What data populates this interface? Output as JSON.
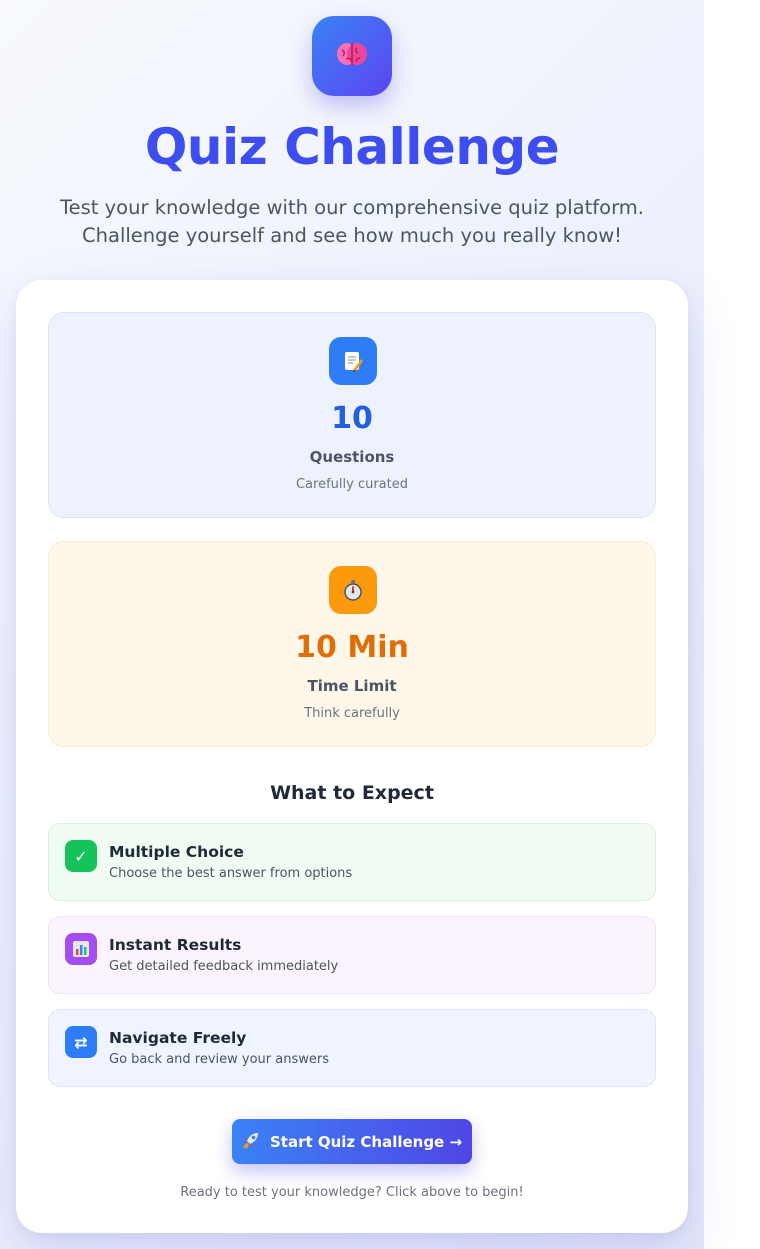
{
  "header": {
    "app_icon": "brain-icon",
    "title": "Quiz Challenge",
    "subtitle": "Test your knowledge with our comprehensive quiz platform. Challenge yourself and see how much you really know!"
  },
  "stats": [
    {
      "icon": "memo-icon",
      "value": "10",
      "label": "Questions",
      "sub": "Carefully curated",
      "accent": "#1f5fe0"
    },
    {
      "icon": "stopwatch-icon",
      "value": "10 Min",
      "label": "Time Limit",
      "sub": "Think carefully",
      "accent": "#de6f07"
    }
  ],
  "expect": {
    "heading": "What to Expect",
    "items": [
      {
        "icon": "checkmark-icon",
        "title": "Multiple Choice",
        "desc": "Choose the best answer from options",
        "color": "#16c35a"
      },
      {
        "icon": "bar-chart-icon",
        "title": "Instant Results",
        "desc": "Get detailed feedback immediately",
        "color": "#a64df2"
      },
      {
        "icon": "swap-arrows-icon",
        "title": "Navigate Freely",
        "desc": "Go back and review your answers",
        "color": "#2f7df6"
      }
    ]
  },
  "cta": {
    "icon": "rocket-icon",
    "label": "Start Quiz Challenge →",
    "note": "Ready to test your knowledge? Click above to begin!"
  }
}
